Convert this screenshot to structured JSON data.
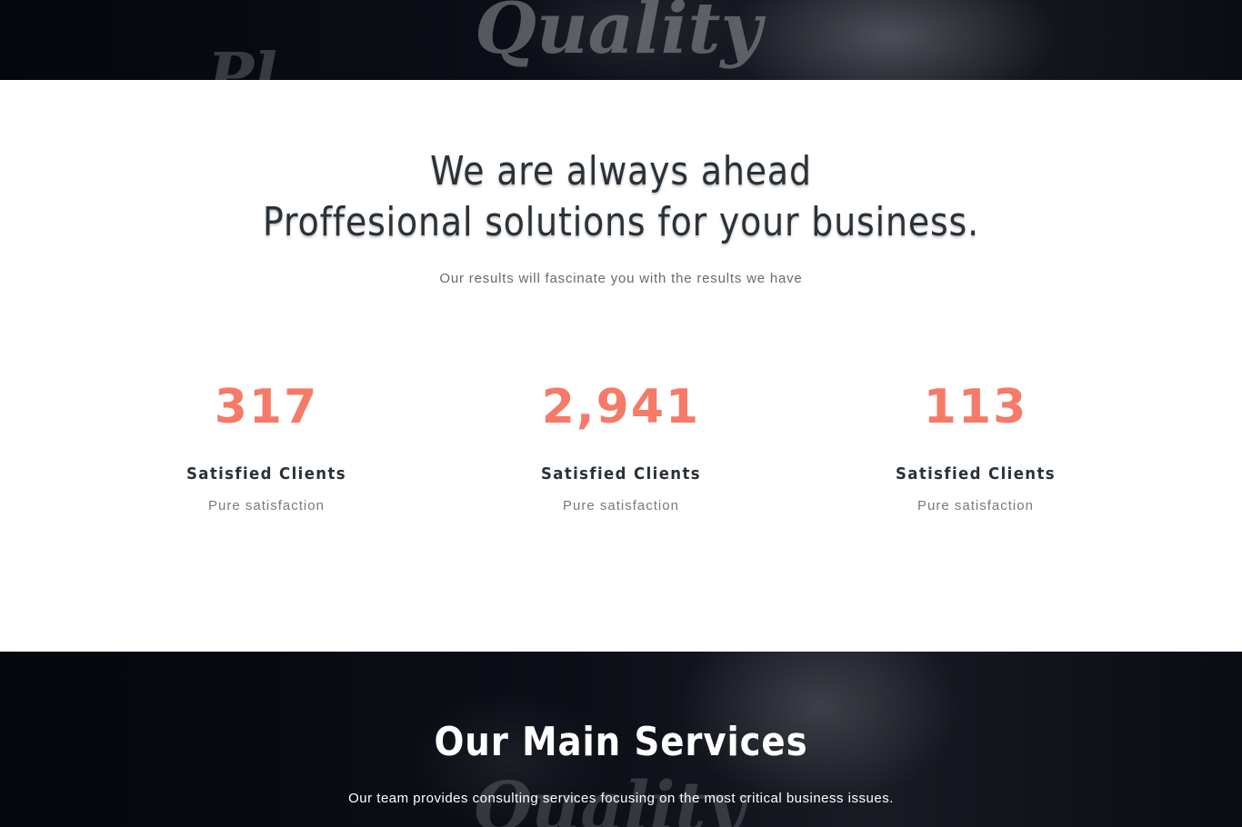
{
  "hero": {
    "background_word_1": "Quality",
    "background_word_2": "Pl"
  },
  "stats_section": {
    "heading_line_1": "We are always ahead",
    "heading_line_2": "Proffesional solutions for your business.",
    "subtitle": "Our results will fascinate you with the results we have",
    "accent_color": "#f57a68",
    "stats": [
      {
        "value": "317",
        "label": "Satisfied Clients",
        "description": "Pure satisfaction"
      },
      {
        "value": "2,941",
        "label": "Satisfied Clients",
        "description": "Pure satisfaction"
      },
      {
        "value": "113",
        "label": "Satisfied Clients",
        "description": "Pure satisfaction"
      }
    ]
  },
  "services_section": {
    "title": "Our Main Services",
    "subtitle": "Our team provides consulting services focusing on the most critical business issues.",
    "background_word": "Quality"
  }
}
